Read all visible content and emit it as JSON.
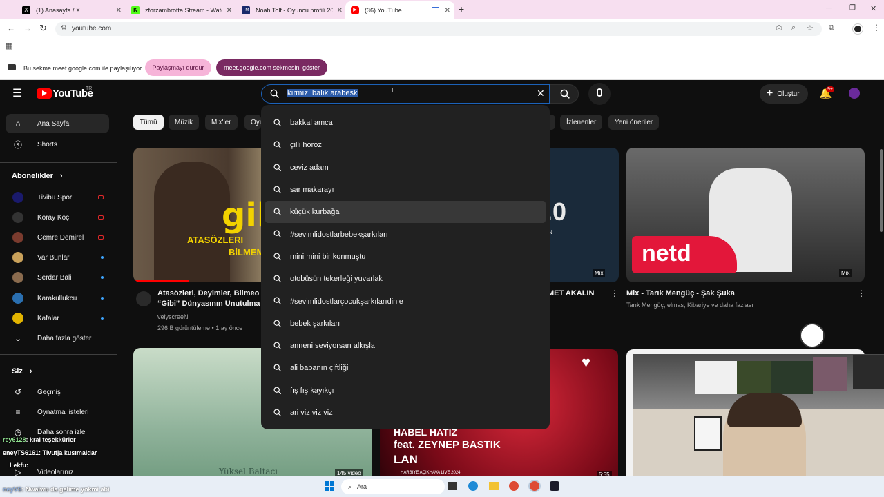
{
  "browser": {
    "tabs": [
      {
        "label": "(1) Anasayfa / X",
        "color": "#000000",
        "glyph": "X"
      },
      {
        "label": "zforzambrotta Stream - Watch l",
        "color": "#53fc18",
        "glyph": "K"
      },
      {
        "label": "Noah Tolf - Oyuncu profili 2023",
        "color": "#1a2a6c",
        "glyph": "TM"
      },
      {
        "label": "(36) YouTube",
        "color": "#ff0000",
        "glyph": "▶"
      }
    ],
    "new_tab_glyph": "+",
    "url": "youtube.com"
  },
  "share_bar": {
    "message": "Bu sekme meet.google.com ile paylaşılıyor",
    "stop_button": "Paylaşmayı durdur",
    "show_button": "meet.google.com sekmesini göster"
  },
  "youtube": {
    "logo_text": "YouTube",
    "logo_region": "TR",
    "search": {
      "query": "kırmızı balık arabesk",
      "suggestions": [
        "bakkal amca",
        "çilli horoz",
        "ceviz adam",
        "sar makarayı",
        "küçük kurbağa",
        "#sevimlidostlarbebekşarkıları",
        "mini mini bir konmuştu",
        "otobüsün tekerleği yuvarlak",
        "#sevimlidostlarçocukşarkılarıdinle",
        "bebek şarkıları",
        "anneni seviyorsan alkışla",
        "ali babanın çiftliği",
        "fış fış kayıkçı",
        "ari viz viz viz"
      ]
    },
    "create_label": "Oluştur",
    "notification_badge": "9+",
    "sidebar": {
      "main": [
        {
          "label": "Ana Sayfa",
          "icon": "home-icon"
        },
        {
          "label": "Shorts",
          "icon": "shorts-icon"
        }
      ],
      "subs_header": "Abonelikler",
      "subs": [
        {
          "label": "Tivibu Spor",
          "color": "#1a1a6c",
          "status": "live"
        },
        {
          "label": "Koray Koç",
          "color": "#333333",
          "status": "live"
        },
        {
          "label": "Cemre Demirel",
          "color": "#7a3b2e",
          "status": "live"
        },
        {
          "label": "Var Bunlar",
          "color": "#c9a15a",
          "status": "new"
        },
        {
          "label": "Serdar Bali",
          "color": "#8a6b4e",
          "status": "new"
        },
        {
          "label": "Karakullukcu",
          "color": "#2a6fb0",
          "status": "new"
        },
        {
          "label": "Kafalar",
          "color": "#e2b400",
          "status": "new"
        }
      ],
      "show_more": "Daha fazla göster",
      "you_header": "Siz",
      "you_items": [
        {
          "label": "Geçmiş",
          "icon": "history-icon"
        },
        {
          "label": "Oynatma listeleri",
          "icon": "playlist-icon"
        },
        {
          "label": "Daha sonra izle",
          "icon": "watch-later-icon"
        },
        {
          "label": "Videolarınız",
          "icon": "your-videos-icon"
        }
      ]
    },
    "chips": [
      "Tümü",
      "Müzik",
      "Mix'ler",
      "Oyu",
      "İzlenenler",
      "Yeni öneriler"
    ],
    "videos": [
      {
        "title_line1": "Atasözleri, Deyimler, Bilmeo",
        "title_line2": "“Gibi” Dünyasının Unutulma",
        "channel": "velyscreeN",
        "meta": "296 B görüntüleme • 1 ay önce",
        "thumb_text1": "gib",
        "thumb_text2": "ATASÖZLERI",
        "thumb_text3": "BİLMEM"
      },
      {
        "title_line1": "MET AKALIN",
        "thumb_text": ".0",
        "thumb_sub": "N",
        "badge": "Mix"
      },
      {
        "title_line1": "Mix - Tarık Mengüç - Şak Şuka",
        "meta": "Tarık Mengüç, elmas, Kibariye ve daha fazlası",
        "badge": "Mix",
        "logo": "netd"
      },
      {
        "thumb_text": "Yüksel Baltacı",
        "duration": "145 video"
      },
      {
        "thumb_text1": "HABEL HATIZ",
        "thumb_text2": "feat. ZEYNEP BASTIK",
        "thumb_text3": "LAN",
        "thumb_sub": "HARBIYE AÇIKHAVA LIVE 2024",
        "duration": "5:55"
      }
    ]
  },
  "overlay": {
    "chat": [
      {
        "user": "rey6128",
        "msg": ": kral teşekkürler"
      },
      {
        "user": "eneyTS6161",
        "msg": ": Tivutja kusımaldar"
      },
      {
        "user": "Lekfu",
        "msg": ":"
      },
      {
        "user": "neyVS",
        "msg": ": Nwaiwu da gelime yokmi abi"
      }
    ]
  },
  "taskbar": {
    "search_label": "Ara"
  }
}
